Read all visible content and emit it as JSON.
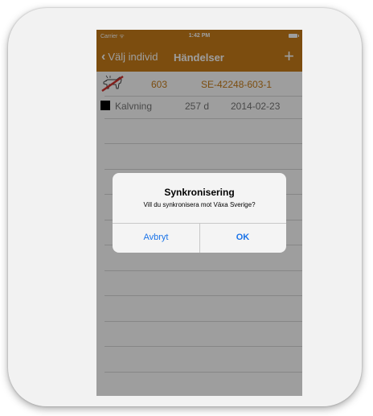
{
  "statusbar": {
    "carrier": "Carrier ᯤ",
    "time": "1:42 PM"
  },
  "navbar": {
    "back_label": "Välj individ",
    "title": "Händelser",
    "add_label": "+"
  },
  "animal": {
    "number": "603",
    "code": "SE-42248-603-1"
  },
  "events": [
    {
      "name": "Kalvning",
      "days": "257 d",
      "date": "2014-02-23"
    }
  ],
  "alert": {
    "title": "Synkronisering",
    "message": "Vill du synkronisera mot Växa Sverige?",
    "cancel_label": "Avbryt",
    "ok_label": "OK"
  },
  "colors": {
    "accent": "#c87d19",
    "link": "#1a73e8"
  }
}
